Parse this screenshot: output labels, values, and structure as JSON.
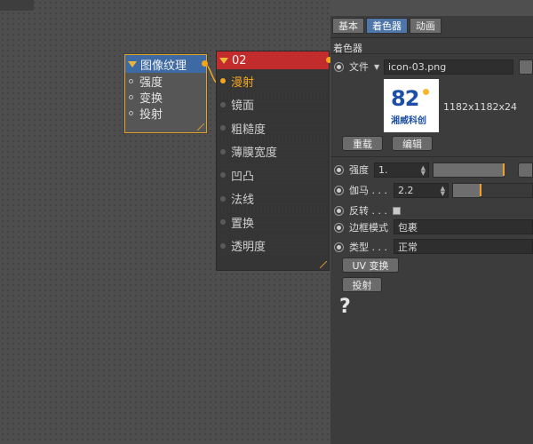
{
  "panel": {
    "tabs": [
      {
        "label": "基本",
        "active": false
      },
      {
        "label": "着色器",
        "active": true
      },
      {
        "label": "动画",
        "active": false
      }
    ],
    "section_title": "着色器",
    "file_label": "文件",
    "file_value": "icon-03.png",
    "preview_brand_number": "82",
    "preview_brand_text": "湘威科创",
    "image_info": "1182x1182x24",
    "reload_label": "重载",
    "edit_label": "编辑",
    "strength_label": "强度",
    "strength_value": "1.",
    "gamma_label": "伽马 . . .",
    "gamma_value": "2.2",
    "invert_label": "反转 . . .",
    "border_label": "边框模式",
    "border_value": "包裹",
    "type_label": "类型 . . .",
    "type_value": "正常",
    "uv_button": "UV 变换",
    "projection_button": "投射",
    "help_glyph": "?"
  },
  "nodes": {
    "image_texture": {
      "title": "图像纹理",
      "inputs": [
        "强度",
        "变换",
        "投射"
      ]
    },
    "material": {
      "title": "02",
      "rows": [
        "漫射",
        "镜面",
        "粗糙度",
        "薄膜宽度",
        "凹凸",
        "法线",
        "置换",
        "透明度"
      ],
      "connected_row": "漫射"
    }
  },
  "colors": {
    "accent": "#f1a720",
    "node_header_blue": "#3d6aa3",
    "node_header_red": "#c32c2c",
    "tab_active": "#4f76a9"
  }
}
